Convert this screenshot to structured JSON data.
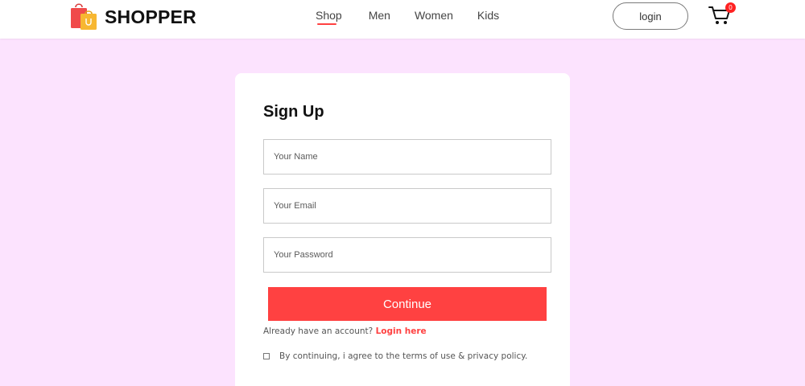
{
  "header": {
    "brand": "SHOPPER",
    "menu": [
      {
        "label": "Shop",
        "active": true
      },
      {
        "label": "Men",
        "active": false
      },
      {
        "label": "Women",
        "active": false
      },
      {
        "label": "Kids",
        "active": false
      }
    ],
    "login_label": "login",
    "cart_count": "0",
    "accent_color": "#ff4141"
  },
  "signup": {
    "title": "Sign Up",
    "name_placeholder": "Your Name",
    "email_placeholder": "Your Email",
    "password_placeholder": "Your Password",
    "continue_label": "Continue",
    "already_text": "Already have an account?",
    "login_link": "Login here",
    "agree_text": "By continuing, i agree to the terms of use & privacy policy."
  }
}
